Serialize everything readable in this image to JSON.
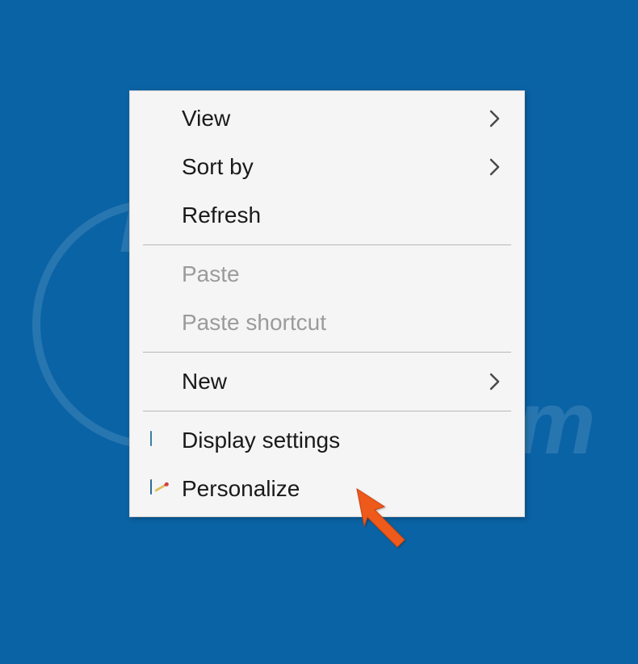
{
  "menu": {
    "items": [
      {
        "label": "View",
        "submenu": true,
        "disabled": false,
        "icon": null
      },
      {
        "label": "Sort by",
        "submenu": true,
        "disabled": false,
        "icon": null
      },
      {
        "label": "Refresh",
        "submenu": false,
        "disabled": false,
        "icon": null
      },
      {
        "label": "Paste",
        "submenu": false,
        "disabled": true,
        "icon": null
      },
      {
        "label": "Paste shortcut",
        "submenu": false,
        "disabled": true,
        "icon": null
      },
      {
        "label": "New",
        "submenu": true,
        "disabled": false,
        "icon": null
      },
      {
        "label": "Display settings",
        "submenu": false,
        "disabled": false,
        "icon": "monitor"
      },
      {
        "label": "Personalize",
        "submenu": false,
        "disabled": false,
        "icon": "personalize"
      }
    ]
  },
  "watermark": {
    "text": "PCrisk.com"
  }
}
